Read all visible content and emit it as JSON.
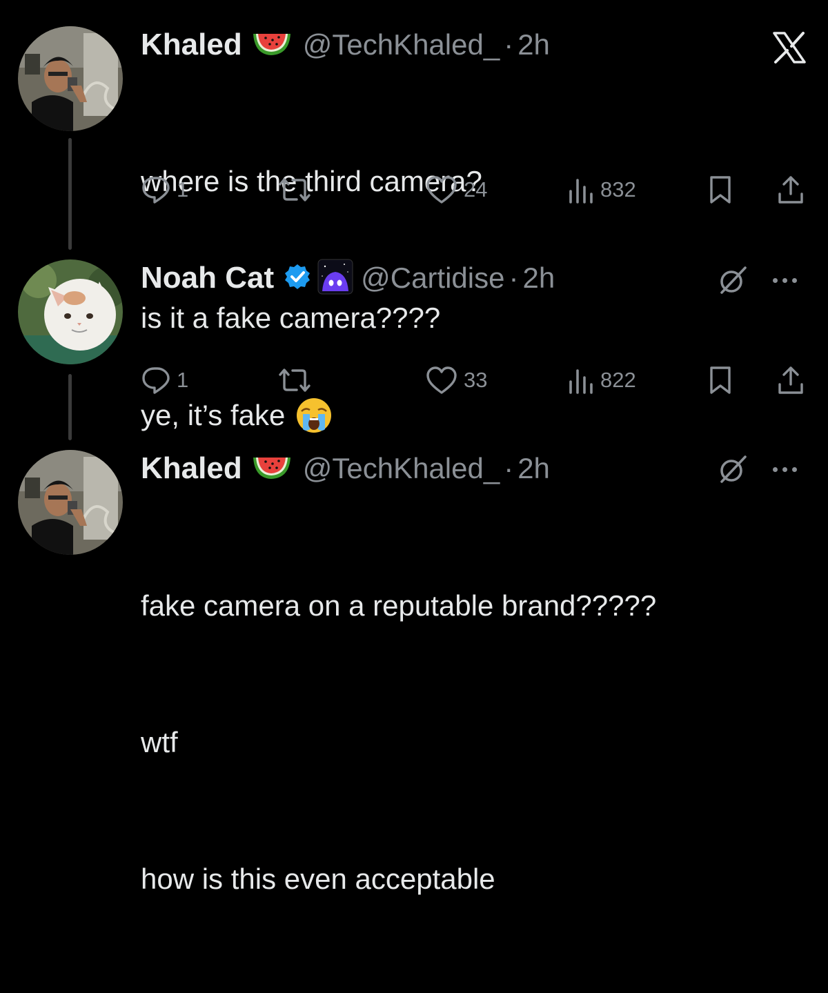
{
  "tweets": [
    {
      "name": "Khaled",
      "handle": "@TechKhaled_",
      "separator": "·",
      "time": "2h",
      "lines": [
        "where is the third camera?",
        "is it a fake camera????"
      ],
      "replies": "1",
      "retweets": "",
      "likes": "24",
      "views": "832"
    },
    {
      "name": "Noah Cat",
      "handle": "@Cartidise",
      "separator": "·",
      "time": "2h",
      "lines": [
        "ye, it’s fake"
      ],
      "replies": "1",
      "retweets": "",
      "likes": "33",
      "views": "822"
    },
    {
      "name": "Khaled",
      "handle": "@TechKhaled_",
      "separator": "·",
      "time": "2h",
      "lines": [
        "fake camera on a reputable brand?????",
        "wtf",
        "how is this even acceptable"
      ]
    }
  ],
  "colors": {
    "background": "#000000",
    "text": "#e7e9ea",
    "muted": "#8b9096",
    "verified": "#1d9bf0"
  },
  "icons": [
    "x-logo-icon",
    "reply-icon",
    "retweet-icon",
    "like-icon",
    "views-icon",
    "bookmark-icon",
    "share-icon",
    "grok-icon",
    "more-icon",
    "watermelon-icon",
    "verified-badge-icon",
    "crying-face-icon"
  ]
}
